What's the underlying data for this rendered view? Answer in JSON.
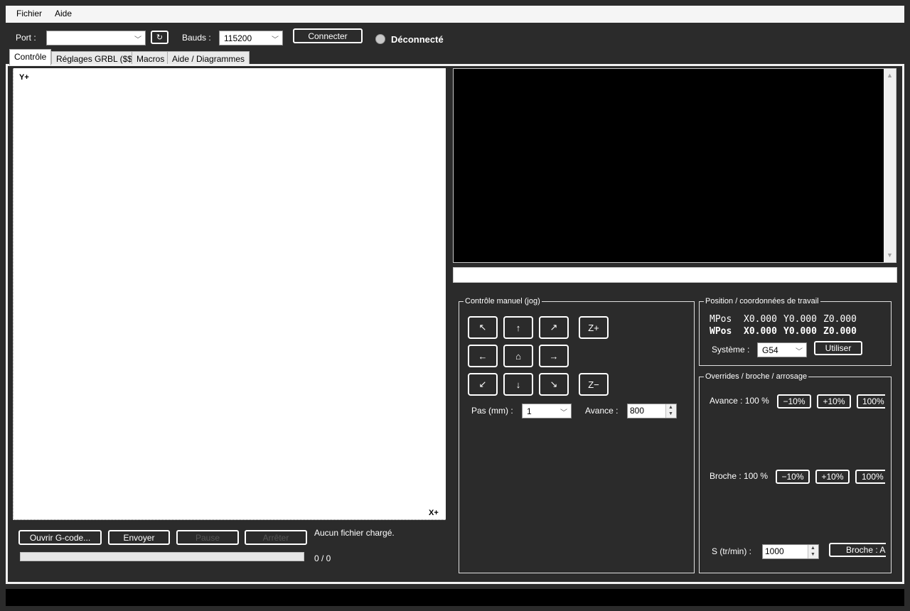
{
  "menu": {
    "file": "Fichier",
    "help": "Aide"
  },
  "toolbar": {
    "port_label": "Port :",
    "port_value": "",
    "refresh_label": "↻",
    "baud_label": "Bauds :",
    "baud_value": "115200",
    "connect_label": "Connecter",
    "status_text": "Déconnecté",
    "status_color": "#c8c8c8"
  },
  "tabs": [
    {
      "label": "Contrôle",
      "active": true
    },
    {
      "label": "Réglages GRBL ($$)",
      "active": false
    },
    {
      "label": "Macros",
      "active": false
    },
    {
      "label": "Aide / Diagrammes",
      "active": false
    }
  ],
  "canvas": {
    "y_axis": "Y+",
    "x_axis": "X+"
  },
  "file_controls": {
    "open_label": "Ouvrir G-code...",
    "send_label": "Envoyer",
    "pause_label": "Pause",
    "stop_label": "Arrêter",
    "status_text": "Aucun fichier chargé.",
    "progress_text": "0 / 0",
    "progress_fraction": 0
  },
  "console": {
    "text": "",
    "command": ""
  },
  "jog": {
    "title": "Contrôle manuel (jog)",
    "up_left": "↖",
    "up": "↑",
    "up_right": "↗",
    "z_plus": "Z+",
    "left": "←",
    "home": "⌂",
    "right": "→",
    "down_left": "↙",
    "down": "↓",
    "down_right": "↘",
    "z_minus": "Z−",
    "step_label": "Pas (mm) :",
    "step_value": "1",
    "feed_label": "Avance :",
    "feed_value": "800"
  },
  "position": {
    "title": "Position / coordonnées de travail",
    "mpos_label": "MPos",
    "mpos_x": "X0.000",
    "mpos_y": "Y0.000",
    "mpos_z": "Z0.000",
    "wpos_label": "WPos",
    "wpos_x": "X0.000",
    "wpos_y": "Y0.000",
    "wpos_z": "Z0.000",
    "system_label": "Système :",
    "system_value": "G54",
    "use_label": "Utiliser"
  },
  "overrides": {
    "title": "Overrides / broche / arrosage",
    "feed_label": "Avance : 100 %",
    "spindle_label": "Broche : 100 %",
    "minus10": "−10%",
    "plus10": "+10%",
    "reset": "100%",
    "s_label": "S (tr/min) :",
    "s_value": "1000",
    "spindle_btn": "Broche : A"
  }
}
